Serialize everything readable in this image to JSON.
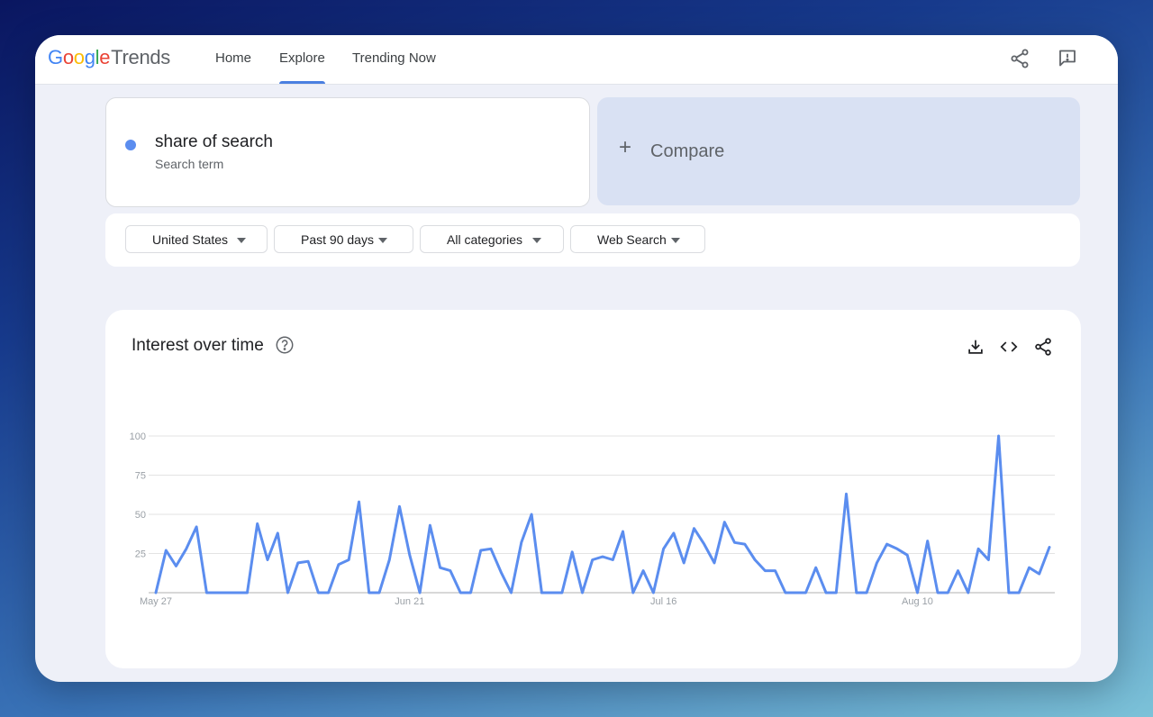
{
  "header": {
    "logo_google": [
      "G",
      "o",
      "o",
      "g",
      "l",
      "e"
    ],
    "logo_trends": "Trends",
    "nav": [
      "Home",
      "Explore",
      "Trending Now"
    ],
    "active_nav": "Explore",
    "icons": [
      "share-icon",
      "feedback-icon"
    ]
  },
  "search": {
    "term": "share of search",
    "term_type": "Search term",
    "term_color": "#5b8def",
    "compare_label": "Compare"
  },
  "filters": {
    "region": "United States",
    "time_range": "Past 90 days",
    "category": "All categories",
    "search_type": "Web Search"
  },
  "card": {
    "title": "Interest over time",
    "icons": [
      "help-icon",
      "download-icon",
      "embed-icon",
      "share-icon"
    ]
  },
  "chart_data": {
    "type": "line",
    "title": "Interest over time",
    "x_tick_labels": [
      "May 27",
      "Jun 21",
      "Jul 16",
      "Aug 10"
    ],
    "x_tick_index": [
      0,
      25,
      50,
      75
    ],
    "y_ticks": [
      25,
      50,
      75,
      100
    ],
    "ylim": [
      0,
      100
    ],
    "grid": true,
    "series": [
      {
        "color": "#5b8def",
        "values": [
          0,
          27,
          17,
          28,
          42,
          0,
          0,
          0,
          0,
          0,
          44,
          21,
          38,
          0,
          19,
          20,
          0,
          0,
          18,
          21,
          58,
          0,
          0,
          21,
          55,
          24,
          0,
          43,
          16,
          14,
          0,
          0,
          27,
          28,
          13,
          0,
          32,
          50,
          0,
          0,
          0,
          26,
          0,
          21,
          23,
          21,
          39,
          0,
          14,
          0,
          28,
          38,
          19,
          41,
          31,
          19,
          45,
          32,
          31,
          21,
          14,
          14,
          0,
          0,
          0,
          16,
          0,
          0,
          63,
          0,
          0,
          19,
          31,
          28,
          24,
          0,
          33,
          0,
          0,
          14,
          0,
          28,
          21,
          100,
          0,
          0,
          16,
          12,
          29
        ]
      }
    ]
  }
}
